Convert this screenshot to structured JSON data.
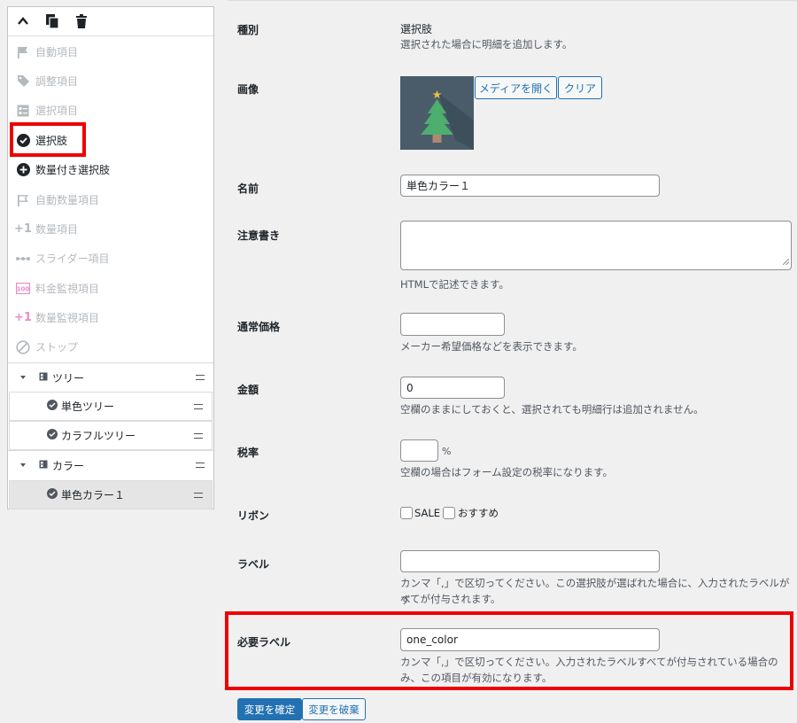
{
  "palette": {
    "items": [
      {
        "label": "自動項目",
        "icon": "flag-icon"
      },
      {
        "label": "調整項目",
        "icon": "tag-icon"
      },
      {
        "label": "選択項目",
        "icon": "list-icon"
      },
      {
        "label": "選択肢",
        "icon": "check-circle-icon"
      },
      {
        "label": "数量付き選択肢",
        "icon": "plus-circle-icon"
      },
      {
        "label": "自動数量項目",
        "icon": "flag-outline-icon"
      },
      {
        "label": "数量項目",
        "icon": "plus-one-icon"
      },
      {
        "label": "スライダー項目",
        "icon": "slider-icon"
      },
      {
        "label": "料金監視項目",
        "icon": "counter-icon"
      },
      {
        "label": "数量監視項目",
        "icon": "plus-one-icon"
      },
      {
        "label": "ストップ",
        "icon": "stop-icon"
      }
    ]
  },
  "tree": {
    "tree_group": "ツリー",
    "tree_child_1": "単色ツリー",
    "tree_child_2": "カラフルツリー",
    "color_group": "カラー",
    "color_child_1": "単色カラー１"
  },
  "form": {
    "type_label": "種別",
    "type_value": "選択肢",
    "type_desc": "選択された場合に明細を追加します。",
    "image_label": "画像",
    "media_button": "メディアを開く",
    "clear_button": "クリア",
    "name_label": "名前",
    "name_value": "単色カラー１",
    "note_label": "注意書き",
    "note_desc": "HTMLで記述できます。",
    "regular_price_label": "通常価格",
    "regular_price_desc": "メーカー希望価格などを表示できます。",
    "amount_label": "金額",
    "amount_value": "0",
    "amount_desc": "空欄のままにしておくと、選択されても明細行は追加されません。",
    "tax_label": "税率",
    "tax_unit": "%",
    "tax_desc": "空欄の場合はフォーム設定の税率になります。",
    "ribbon_label": "リボン",
    "ribbon_sale": "SALE",
    "ribbon_recommend": "おすすめ",
    "tag_label": "ラベル",
    "tag_desc_1": "カンマ「,」で区切ってください。この選択肢が選ばれた場合に、入力されたラベルがす",
    "tag_desc_2": "べてが付与されます。",
    "required_label": "必要ラベル",
    "required_value": "one_color",
    "required_desc_1": "カンマ「,」で区切ってください。入力されたラベルすべてが付与されている場合の",
    "required_desc_2": "み、この項目が有効になります。",
    "confirm_button": "変更を確定",
    "discard_button": "変更を破棄"
  },
  "colors": {
    "accent": "#2271b1",
    "highlight": "#ee0000",
    "tree_bg": "#4a5c6a",
    "tree_green": "#4caf6e",
    "star": "#f0c040"
  }
}
